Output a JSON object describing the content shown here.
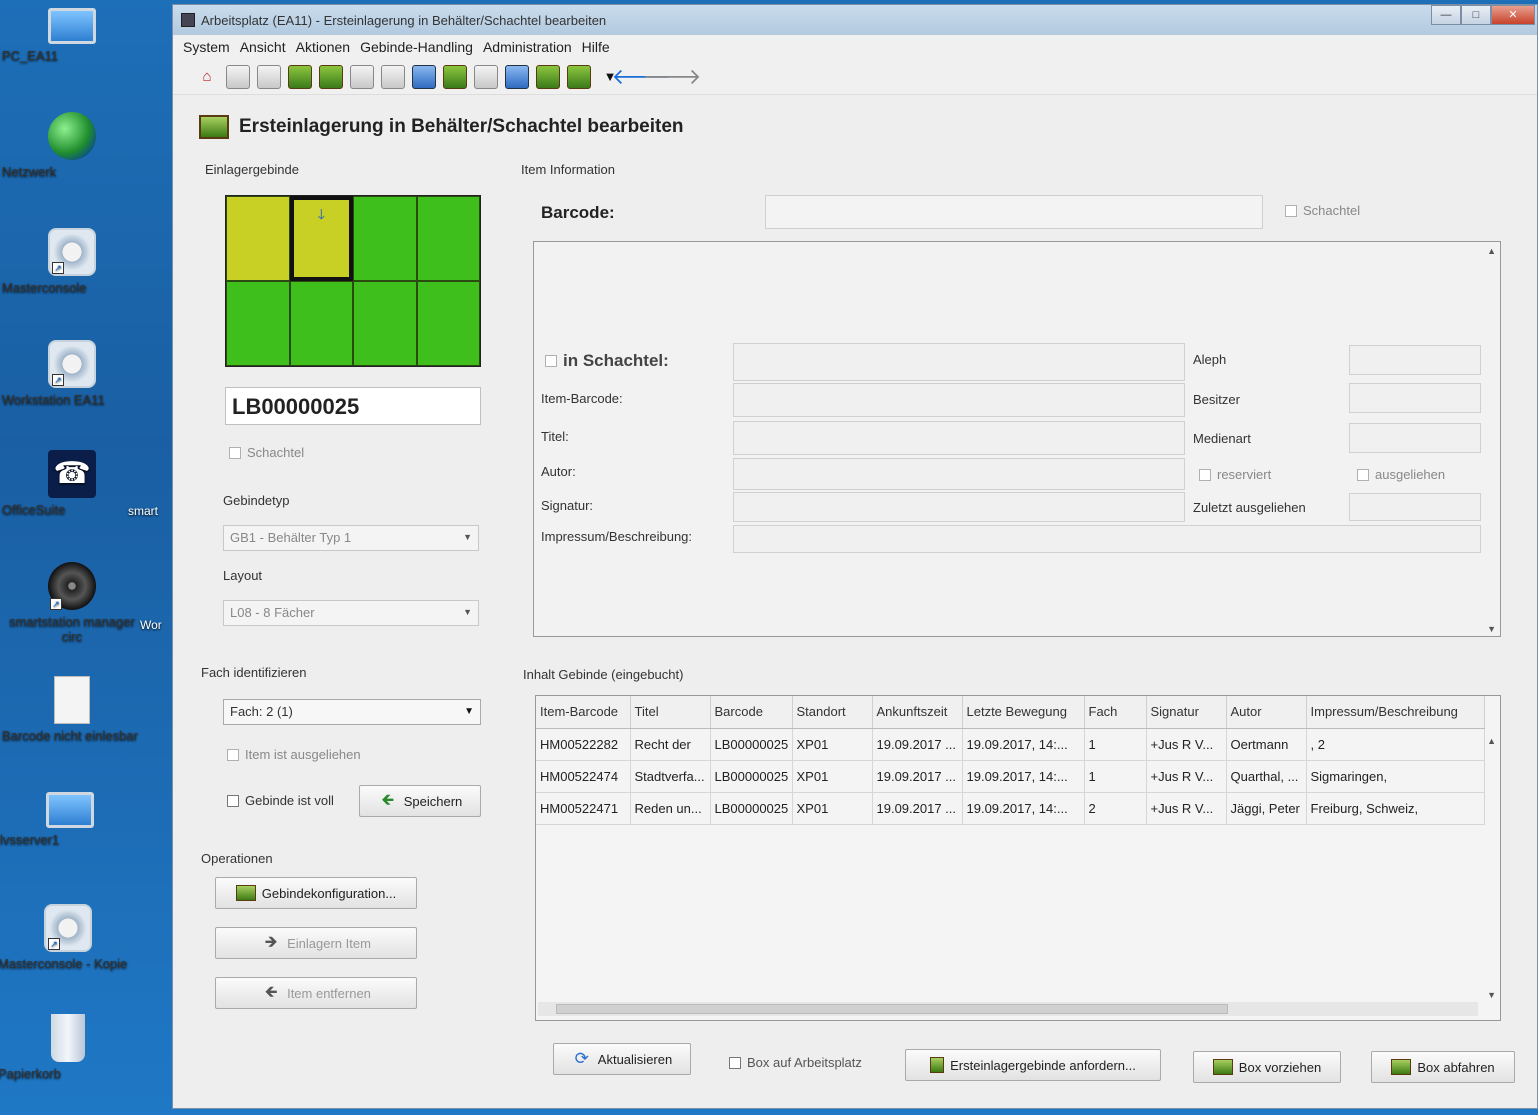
{
  "desktop": {
    "icons": [
      {
        "label": "PC_EA11"
      },
      {
        "label": "Netzwerk"
      },
      {
        "label": "Masterconsole"
      },
      {
        "label": "Workstation EA11"
      },
      {
        "label": "OfficeSuite"
      },
      {
        "label": "smartstation manager circ"
      },
      {
        "label": "Barcode nicht einlesbar"
      },
      {
        "label": "lvsserver1"
      },
      {
        "label": "Masterconsole - Kopie"
      },
      {
        "label": "Papierkorb"
      }
    ],
    "partial_labels": {
      "smart": "smart",
      "wor": "Wor"
    }
  },
  "window": {
    "title": "Arbeitsplatz (EA11) - Ersteinlagerung in Behälter/Schachtel bearbeiten",
    "menu": [
      "System",
      "Ansicht",
      "Aktionen",
      "Gebinde-Handling",
      "Administration",
      "Hilfe"
    ]
  },
  "page_title": "Ersteinlagerung in Behälter/Schachtel bearbeiten",
  "left": {
    "section_einlager": "Einlagergebinde",
    "bin_id": "LB00000025",
    "schachtel_label": "Schachtel",
    "gebindetyp_label": "Gebindetyp",
    "gebindetyp_value": "GB1 - Behälter Typ 1",
    "layout_label": "Layout",
    "layout_value": "L08 - 8 Fächer",
    "fach_section": "Fach identifizieren",
    "fach_value": "Fach: 2 (1)",
    "item_ausgeliehen": "Item ist ausgeliehen",
    "gebinde_voll": "Gebinde ist voll",
    "speichern": "Speichern",
    "operationen": "Operationen",
    "gebindekonfiguration": "Gebindekonfiguration...",
    "einlagern_item": "Einlagern Item",
    "item_entfernen": "Item entfernen"
  },
  "item_info": {
    "section": "Item Information",
    "barcode_label": "Barcode:",
    "schachtel": "Schachtel",
    "in_schachtel": "in Schachtel:",
    "item_barcode": "Item-Barcode:",
    "titel": "Titel:",
    "autor": "Autor:",
    "signatur": "Signatur:",
    "impressum": "Impressum/Beschreibung:",
    "aleph": "Aleph",
    "besitzer": "Besitzer",
    "medienart": "Medienart",
    "reserviert": "reserviert",
    "ausgeliehen": "ausgeliehen",
    "zuletzt": "Zuletzt ausgeliehen"
  },
  "inhalt": {
    "section": "Inhalt Gebinde (eingebucht)",
    "columns": [
      "Item-Barcode",
      "Titel",
      "Barcode",
      "Standort",
      "Ankunftszeit",
      "Letzte Bewegung",
      "Fach",
      "Signatur",
      "Autor",
      "Impressum/Beschreibung"
    ],
    "rows": [
      [
        "HM00522282",
        "Recht der",
        "LB00000025",
        "XP01",
        "19.09.2017 ...",
        "19.09.2017, 14:...",
        "1",
        "+Jus R V...",
        "Oertmann",
        ", 2"
      ],
      [
        "HM00522474",
        "Stadtverfa...",
        "LB00000025",
        "XP01",
        "19.09.2017 ...",
        "19.09.2017, 14:...",
        "1",
        "+Jus R V...",
        "Quarthal, ...",
        "Sigmaringen,"
      ],
      [
        "HM00522471",
        "Reden un...",
        "LB00000025",
        "XP01",
        "19.09.2017 ...",
        "19.09.2017, 14:...",
        "2",
        "+Jus R V...",
        "Jäggi, Peter",
        "Freiburg, Schweiz,"
      ]
    ]
  },
  "bottom": {
    "aktualisieren": "Aktualisieren",
    "box_arbeitsplatz": "Box auf Arbeitsplatz",
    "anfordern": "Ersteinlagergebinde anfordern...",
    "vorziehen": "Box vorziehen",
    "abfahren": "Box abfahren"
  }
}
